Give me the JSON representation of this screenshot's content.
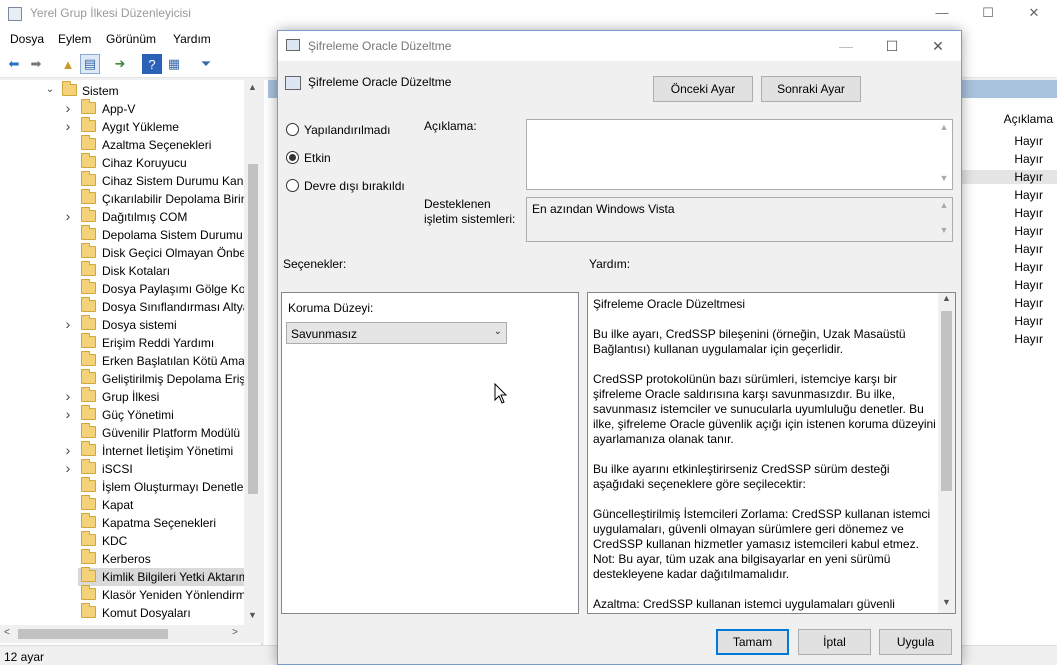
{
  "main_window": {
    "title": "Yerel Grup İlkesi Düzenleyicisi",
    "menu": [
      "Dosya",
      "Eylem",
      "Görünüm",
      "Yardım"
    ],
    "status": "12 ayar"
  },
  "tree": {
    "root": "Sistem",
    "items": [
      {
        "label": "App-V",
        "expandable": true
      },
      {
        "label": "Aygıt Yükleme",
        "expandable": true
      },
      {
        "label": "Azaltma Seçenekleri",
        "expandable": false
      },
      {
        "label": "Cihaz Koruyucu",
        "expandable": false
      },
      {
        "label": "Cihaz Sistem Durumu Kanıt",
        "expandable": false
      },
      {
        "label": "Çıkarılabilir Depolama Birin",
        "expandable": false
      },
      {
        "label": "Dağıtılmış COM",
        "expandable": true
      },
      {
        "label": "Depolama Sistem Durumu",
        "expandable": false
      },
      {
        "label": "Disk Geçici Olmayan Önbel",
        "expandable": false
      },
      {
        "label": "Disk Kotaları",
        "expandable": false
      },
      {
        "label": "Dosya Paylaşımı Gölge Kop",
        "expandable": false
      },
      {
        "label": "Dosya Sınıflandırması Altya",
        "expandable": false
      },
      {
        "label": "Dosya sistemi",
        "expandable": true
      },
      {
        "label": "Erişim Reddi Yardımı",
        "expandable": false
      },
      {
        "label": "Erken Başlatılan Kötü Amaç",
        "expandable": false
      },
      {
        "label": "Geliştirilmiş Depolama Erişi",
        "expandable": false
      },
      {
        "label": "Grup İlkesi",
        "expandable": true
      },
      {
        "label": "Güç Yönetimi",
        "expandable": true
      },
      {
        "label": "Güvenilir Platform Modülü",
        "expandable": false
      },
      {
        "label": "İnternet İletişim Yönetimi",
        "expandable": true
      },
      {
        "label": "iSCSI",
        "expandable": true
      },
      {
        "label": "İşlem Oluşturmayı Denetle",
        "expandable": false
      },
      {
        "label": "Kapat",
        "expandable": false
      },
      {
        "label": "Kapatma Seçenekleri",
        "expandable": false
      },
      {
        "label": "KDC",
        "expandable": false
      },
      {
        "label": "Kerberos",
        "expandable": false
      },
      {
        "label": "Kimlik Bilgileri Yetki Aktarım",
        "expandable": false,
        "selected": true
      },
      {
        "label": "Klasör Yeniden Yönlendirm",
        "expandable": false
      },
      {
        "label": "Komut Dosyaları",
        "expandable": false
      }
    ]
  },
  "right_pane": {
    "column_header": "Açıklama",
    "states": [
      "Hayır",
      "Hayır",
      "Hayır",
      "Hayır",
      "Hayır",
      "Hayır",
      "Hayır",
      "Hayır",
      "Hayır",
      "Hayır",
      "Hayır",
      "Hayır"
    ]
  },
  "dialog": {
    "title": "Şifreleme Oracle Düzeltme",
    "header_title": "Şifreleme Oracle Düzeltme",
    "prev_button": "Önceki Ayar",
    "next_button": "Sonraki Ayar",
    "radio_not_configured": "Yapılandırılmadı",
    "radio_enabled": "Etkin",
    "radio_disabled": "Devre dışı bırakıldı",
    "selected_radio": "Etkin",
    "comment_label": "Açıklama:",
    "comment_value": "",
    "supported_label_1": "Desteklenen",
    "supported_label_2": "işletim sistemleri:",
    "supported_value": "En azından Windows Vista",
    "options_label": "Seçenekler:",
    "help_label": "Yardım:",
    "protection_level_label": "Koruma Düzeyi:",
    "protection_level_value": "Savunmasız",
    "help_paragraphs": [
      "Şifreleme Oracle Düzeltmesi",
      "Bu ilke ayarı, CredSSP bileşenini (örneğin, Uzak Masaüstü Bağlantısı) kullanan uygulamalar için geçerlidir.",
      "CredSSP protokolünün bazı sürümleri, istemciye karşı bir şifreleme Oracle saldırısına karşı savunmasızdır. Bu ilke, savunmasız istemciler ve sunucularla uyumluluğu denetler. Bu ilke, şifreleme Oracle güvenlik açığı için istenen koruma düzeyini ayarlamanıza olanak tanır.",
      "Bu ilke ayarını etkinleştirirseniz CredSSP sürüm desteği aşağıdaki seçeneklere göre seçilecektir:",
      "Güncelleştirilmiş İstemcileri Zorlama: CredSSP kullanan istemci uygulamaları, güvenli olmayan sürümlere geri dönemez ve CredSSP kullanan hizmetler yamasız istemcileri kabul etmez. Not: Bu ayar, tüm uzak ana bilgisayarlar en yeni sürümü destekleyene kadar dağıtılmamalıdır.",
      "Azaltma: CredSSP kullanan istemci uygulamaları güvenli"
    ],
    "ok_button": "Tamam",
    "cancel_button": "İptal",
    "apply_button": "Uygula"
  }
}
